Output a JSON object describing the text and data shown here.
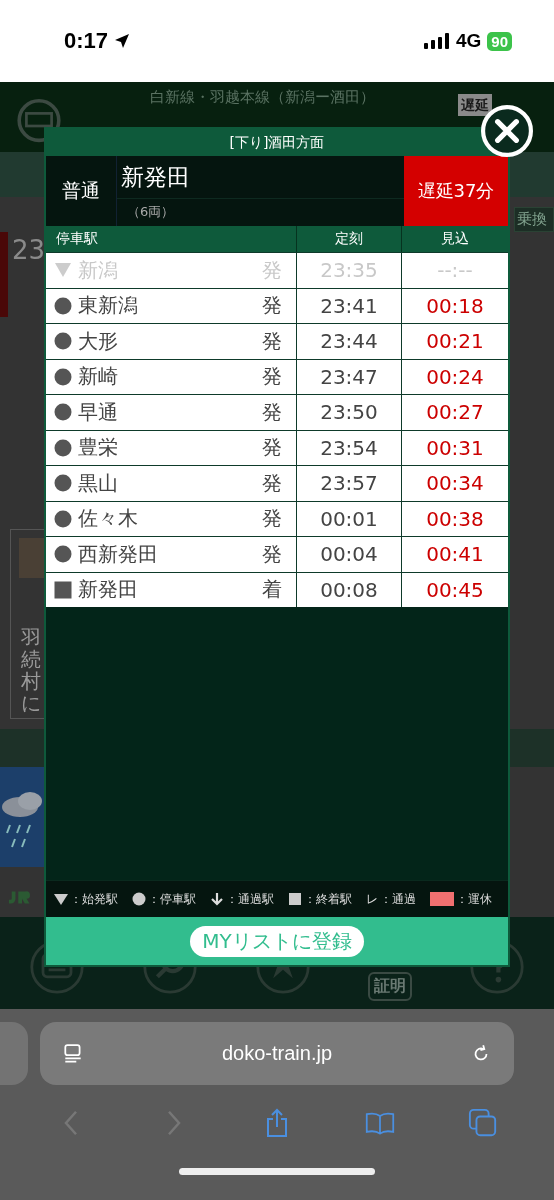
{
  "status_bar": {
    "time": "0:17",
    "network": "4G",
    "battery": "90"
  },
  "page": {
    "route_title": "白新線・羽越本線（新潟ー酒田）",
    "delay_badge": "遅延",
    "transfer": "乗換",
    "time_partial": "23",
    "notice_lines": [
      "羽",
      "続",
      "村",
      "に"
    ],
    "nav_label": "証明"
  },
  "modal": {
    "direction": "[下り]酒田方面",
    "train_type": "普通",
    "destination": "新発田",
    "cars": "（6両）",
    "delay": "遅延37分",
    "columns": [
      "停車駅",
      "定刻",
      "見込"
    ],
    "stops": [
      {
        "kind": "origin",
        "name": "新潟",
        "action": "発",
        "scheduled": "23:35",
        "estimate": "--:--",
        "passed": true
      },
      {
        "kind": "stop",
        "name": "東新潟",
        "action": "発",
        "scheduled": "23:41",
        "estimate": "00:18",
        "passed": false
      },
      {
        "kind": "stop",
        "name": "大形",
        "action": "発",
        "scheduled": "23:44",
        "estimate": "00:21",
        "passed": false
      },
      {
        "kind": "stop",
        "name": "新崎",
        "action": "発",
        "scheduled": "23:47",
        "estimate": "00:24",
        "passed": false
      },
      {
        "kind": "stop",
        "name": "早通",
        "action": "発",
        "scheduled": "23:50",
        "estimate": "00:27",
        "passed": false
      },
      {
        "kind": "stop",
        "name": "豊栄",
        "action": "発",
        "scheduled": "23:54",
        "estimate": "00:31",
        "passed": false
      },
      {
        "kind": "stop",
        "name": "黒山",
        "action": "発",
        "scheduled": "23:57",
        "estimate": "00:34",
        "passed": false
      },
      {
        "kind": "stop",
        "name": "佐々木",
        "action": "発",
        "scheduled": "00:01",
        "estimate": "00:38",
        "passed": false
      },
      {
        "kind": "stop",
        "name": "西新発田",
        "action": "発",
        "scheduled": "00:04",
        "estimate": "00:41",
        "passed": false
      },
      {
        "kind": "terminal",
        "name": "新発田",
        "action": "着",
        "scheduled": "00:08",
        "estimate": "00:45",
        "passed": false
      }
    ],
    "legend": [
      {
        "kind": "triangle",
        "label": "：始発駅"
      },
      {
        "kind": "circle",
        "label": "：停車駅"
      },
      {
        "kind": "arrow",
        "label": "：通過駅"
      },
      {
        "kind": "square",
        "label": "：終着駅"
      },
      {
        "kind": "text",
        "symbol": "レ",
        "label": "：通過"
      },
      {
        "kind": "swatch",
        "color": "#f07070",
        "label": "：運休"
      }
    ],
    "register_button": "MYリストに登録"
  },
  "browser": {
    "url": "doko-train.jp"
  }
}
